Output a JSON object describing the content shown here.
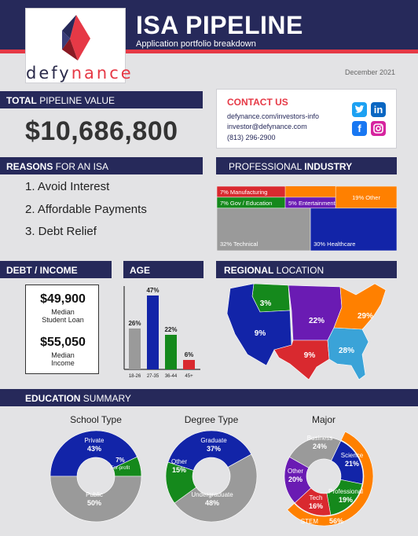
{
  "header": {
    "title": "ISA PIPELINE",
    "subtitle": "Application portfolio breakdown",
    "logo_text_a": "defy",
    "logo_text_b": "nance",
    "date": "December 2021"
  },
  "total": {
    "label_bold": "TOTAL",
    "label_rest": " PIPELINE VALUE",
    "value": "$10,686,800"
  },
  "contact": {
    "title": "CONTACT US",
    "website": "defynance.com/investors-info",
    "email": "investor@defynance.com",
    "phone": "(813) 296-2900",
    "icons": [
      "twitter-icon",
      "linkedin-icon",
      "facebook-icon",
      "instagram-icon"
    ]
  },
  "reasons": {
    "label_bold": "REASONS",
    "label_rest": " FOR AN ISA",
    "items": [
      "1. Avoid Interest",
      "2. Affordable Payments",
      "3. Debt Relief"
    ]
  },
  "industry_header": {
    "label_rest": "PROFESSIONAL ",
    "label_bold": "INDUSTRY"
  },
  "debt_income": {
    "label": "DEBT / INCOME",
    "loan_value": "$49,900",
    "loan_label_1": "Median",
    "loan_label_2": "Student Loan",
    "income_value": "$55,050",
    "income_label_1": "Median",
    "income_label_2": "Income"
  },
  "age_header": {
    "label": "AGE"
  },
  "region_header": {
    "label_bold": "REGIONAL",
    "label_rest": " LOCATION"
  },
  "education_header": {
    "label_bold": "EDUCATION",
    "label_rest": " SUMMARY"
  },
  "colors": {
    "navy": "#26295a",
    "red": "#d9292f",
    "blue": "#1224a8",
    "green": "#15891c",
    "purple": "#6a1bb3",
    "orange": "#ff8000",
    "gray": "#9a9a9a",
    "lightblue": "#3aa3d8"
  },
  "chart_data": [
    {
      "type": "bar",
      "title": "AGE",
      "categories": [
        "18-26",
        "27-35",
        "36-44",
        "45+"
      ],
      "values": [
        26,
        47,
        22,
        6
      ],
      "labels": [
        "26%",
        "47%",
        "22%",
        "6%"
      ],
      "colors": [
        "#9a9a9a",
        "#1224a8",
        "#15891c",
        "#d9292f"
      ],
      "ylim": [
        0,
        50
      ]
    },
    {
      "type": "heatmap",
      "title": "PROFESSIONAL INDUSTRY",
      "categories": [
        "Manufacturing",
        "Gov / Education",
        "Entertainment",
        "Other",
        "Technical",
        "Healthcare"
      ],
      "labels": [
        "7% Manufacturing",
        "7% Gov / Education",
        "5%  Entertainment",
        "19% Other",
        "32% Technical",
        "30% Healthcare"
      ],
      "values": [
        7,
        7,
        5,
        19,
        32,
        30
      ],
      "colors": [
        "#d9292f",
        "#15891c",
        "#6a1bb3",
        "#ff8000",
        "#9a9a9a",
        "#1224a8"
      ]
    },
    {
      "type": "pie",
      "title": "REGIONAL LOCATION",
      "regions": [
        "Northwest",
        "West",
        "Central",
        "Southwest",
        "Southeast",
        "Northeast"
      ],
      "labels": [
        "3%",
        "9%",
        "22%",
        "9%",
        "28%",
        "29%"
      ],
      "values": [
        3,
        9,
        22,
        9,
        28,
        29
      ],
      "colors": [
        "#15891c",
        "#1224a8",
        "#6a1bb3",
        "#d9292f",
        "#3aa3d8",
        "#ff8000"
      ]
    },
    {
      "type": "pie",
      "title": "School Type",
      "categories": [
        "Private",
        "For-profit",
        "Public"
      ],
      "values": [
        43,
        7,
        50
      ],
      "labels": [
        "43%",
        "7%",
        "50%"
      ],
      "colors": [
        "#1224a8",
        "#15891c",
        "#9a9a9a"
      ]
    },
    {
      "type": "pie",
      "title": "Degree Type",
      "categories": [
        "Graduate",
        "Undergraduate",
        "Other"
      ],
      "values": [
        37,
        48,
        15
      ],
      "labels": [
        "37%",
        "48%",
        "15%"
      ],
      "colors": [
        "#1224a8",
        "#9a9a9a",
        "#15891c"
      ]
    },
    {
      "type": "pie",
      "title": "Major",
      "categories": [
        "Science",
        "Professional",
        "Tech",
        "Other",
        "Business"
      ],
      "values": [
        21,
        19,
        16,
        20,
        24
      ],
      "labels": [
        "21%",
        "19%",
        "16%",
        "20%",
        "24%"
      ],
      "colors": [
        "#1224a8",
        "#15891c",
        "#d9292f",
        "#6a1bb3",
        "#9a9a9a"
      ],
      "outer_ring": {
        "label": "STEM",
        "value": 56,
        "value_label": "56%",
        "color": "#ff8000"
      }
    }
  ]
}
